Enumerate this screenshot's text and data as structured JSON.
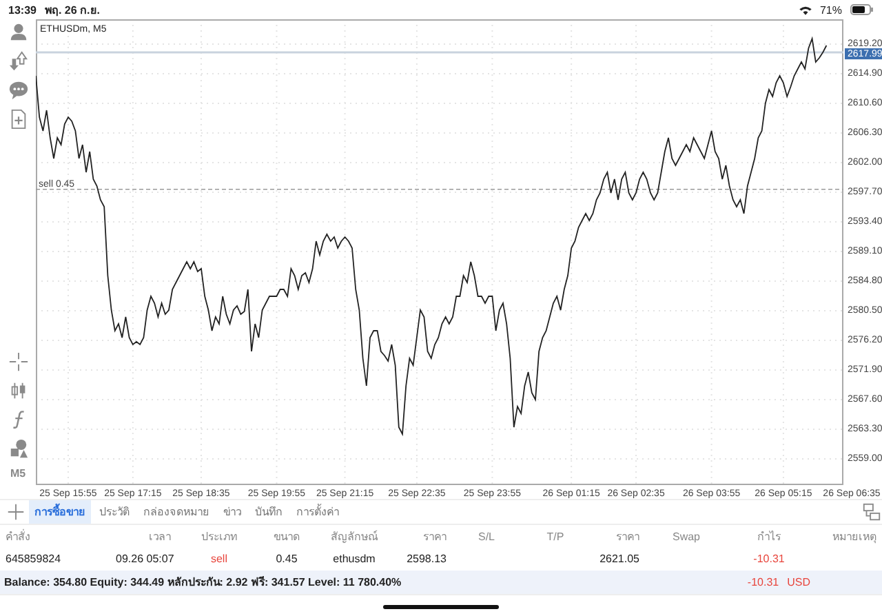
{
  "status_bar": {
    "time": "13:39",
    "date": "พฤ. 26 ก.ย.",
    "battery": "71%"
  },
  "toolbar": {
    "timeframe": "M5"
  },
  "chart": {
    "title": "ETHUSDm, M5",
    "chart_data": {
      "type": "line",
      "ylim": [
        2555.2,
        2622.8
      ],
      "categories": [
        null,
        null,
        null,
        null,
        null,
        null,
        null,
        null,
        null,
        "25 Sep 15:55",
        null,
        null,
        null,
        null,
        null,
        null,
        null,
        null,
        null,
        null,
        null,
        null,
        null,
        null,
        null,
        null,
        null,
        "25 Sep 17:15",
        null,
        null,
        null,
        null,
        null,
        null,
        null,
        null,
        null,
        null,
        null,
        null,
        null,
        null,
        null,
        null,
        null,
        null,
        "25 Sep 18:35",
        null,
        null,
        null,
        null,
        null,
        null,
        null,
        null,
        null,
        null,
        null,
        null,
        null,
        null,
        null,
        null,
        null,
        null,
        null,
        null,
        "25 Sep 19:55",
        null,
        null,
        null,
        null,
        null,
        null,
        null,
        null,
        null,
        null,
        null,
        null,
        null,
        null,
        null,
        null,
        null,
        null,
        "25 Sep 21:15",
        null,
        null,
        null,
        null,
        null,
        null,
        null,
        null,
        null,
        null,
        null,
        null,
        null,
        null,
        null,
        null,
        null,
        null,
        null,
        "25 Sep 22:35",
        null,
        null,
        null,
        null,
        null,
        null,
        null,
        null,
        null,
        null,
        null,
        null,
        null,
        null,
        null,
        null,
        null,
        null,
        null,
        null,
        "25 Sep 23:55",
        null,
        null,
        null,
        null,
        null,
        null,
        null,
        null,
        null,
        null,
        null,
        null,
        null,
        null,
        null,
        null,
        null,
        null,
        null,
        null,
        null,
        "26 Sep 01:15",
        null,
        null,
        null,
        null,
        null,
        null,
        null,
        null,
        null,
        null,
        null,
        null,
        null,
        null,
        null,
        null,
        null,
        "26 Sep 02:35",
        null,
        null,
        null,
        null,
        null,
        null,
        null,
        null,
        null,
        null,
        null,
        null,
        null,
        null,
        null,
        null,
        null,
        null,
        null,
        null,
        "26 Sep 03:55",
        null,
        null,
        null,
        null,
        null,
        null,
        null,
        null,
        null,
        null,
        null,
        null,
        null,
        null,
        null,
        null,
        null,
        null,
        null,
        "26 Sep 05:15",
        null,
        null,
        null,
        null,
        null,
        null,
        null,
        null,
        null,
        null,
        null,
        null,
        null,
        null,
        null,
        null,
        null,
        null,
        "26 Sep 06:35"
      ],
      "yticks": [
        {
          "value": 2619.2,
          "label": "2619.20"
        },
        {
          "value": 2614.9,
          "label": "2614.90"
        },
        {
          "value": 2610.6,
          "label": "2610.60"
        },
        {
          "value": 2606.3,
          "label": "2606.30"
        },
        {
          "value": 2602.0,
          "label": "2602.00"
        },
        {
          "value": 2597.7,
          "label": "2597.70"
        },
        {
          "value": 2593.4,
          "label": "2593.40"
        },
        {
          "value": 2589.1,
          "label": "2589.10"
        },
        {
          "value": 2584.8,
          "label": "2584.80"
        },
        {
          "value": 2580.5,
          "label": "2580.50"
        },
        {
          "value": 2576.2,
          "label": "2576.20"
        },
        {
          "value": 2571.9,
          "label": "2571.90"
        },
        {
          "value": 2567.6,
          "label": "2567.60"
        },
        {
          "value": 2563.3,
          "label": "2563.30"
        },
        {
          "value": 2559.0,
          "label": "2559.00"
        }
      ],
      "series": [
        {
          "color": "#222222",
          "values": [
            2614.6,
            2608.6,
            2606.6,
            2609.6,
            2605.6,
            2602.6,
            2605.6,
            2604.6,
            2607.6,
            2608.6,
            2608.0,
            2606.6,
            2602.6,
            2604.6,
            2600.6,
            2603.6,
            2599.6,
            2598.6,
            2596.6,
            2595.6,
            2585.6,
            2580.6,
            2577.6,
            2578.6,
            2576.6,
            2579.6,
            2576.6,
            2575.6,
            2576.0,
            2575.6,
            2576.6,
            2580.6,
            2582.6,
            2581.6,
            2579.6,
            2581.6,
            2580.0,
            2580.6,
            2583.6,
            2584.6,
            2585.6,
            2586.6,
            2587.6,
            2586.6,
            2587.6,
            2586.2,
            2586.6,
            2582.6,
            2580.6,
            2577.6,
            2579.6,
            2578.6,
            2582.6,
            2580.0,
            2578.6,
            2580.6,
            2581.2,
            2580.0,
            2580.4,
            2583.6,
            2574.6,
            2578.6,
            2576.6,
            2580.6,
            2581.6,
            2582.6,
            2582.6,
            2582.6,
            2583.6,
            2583.6,
            2582.6,
            2586.6,
            2585.6,
            2583.6,
            2585.6,
            2586.0,
            2584.6,
            2586.6,
            2590.6,
            2588.6,
            2590.6,
            2591.6,
            2590.6,
            2591.2,
            2589.6,
            2590.6,
            2591.2,
            2590.6,
            2589.6,
            2583.6,
            2580.6,
            2573.6,
            2569.6,
            2576.6,
            2577.6,
            2577.6,
            2574.6,
            2574.0,
            2573.2,
            2575.6,
            2572.6,
            2563.6,
            2562.6,
            2569.6,
            2573.6,
            2572.6,
            2576.6,
            2580.6,
            2579.6,
            2574.6,
            2573.6,
            2575.6,
            2576.6,
            2578.6,
            2579.6,
            2578.6,
            2579.6,
            2582.6,
            2582.6,
            2585.6,
            2584.6,
            2587.6,
            2585.6,
            2582.6,
            2582.6,
            2581.6,
            2582.6,
            2582.6,
            2577.6,
            2580.6,
            2581.6,
            2578.6,
            2573.6,
            2563.6,
            2566.6,
            2565.6,
            2569.6,
            2571.6,
            2568.6,
            2567.6,
            2574.6,
            2576.6,
            2577.6,
            2579.6,
            2581.6,
            2582.6,
            2580.6,
            2583.6,
            2585.6,
            2589.6,
            2590.6,
            2592.6,
            2593.6,
            2594.6,
            2593.6,
            2594.6,
            2596.6,
            2597.6,
            2599.6,
            2600.6,
            2597.6,
            2599.6,
            2596.6,
            2599.6,
            2600.6,
            2597.6,
            2596.6,
            2597.6,
            2599.6,
            2600.6,
            2599.6,
            2597.6,
            2596.6,
            2597.6,
            2600.6,
            2603.6,
            2605.6,
            2602.6,
            2601.6,
            2602.6,
            2603.6,
            2604.6,
            2603.6,
            2605.6,
            2604.6,
            2603.6,
            2602.6,
            2604.6,
            2606.6,
            2603.6,
            2602.6,
            2599.6,
            2601.6,
            2598.6,
            2596.6,
            2595.6,
            2596.6,
            2594.6,
            2598.6,
            2600.6,
            2602.6,
            2605.6,
            2606.6,
            2610.6,
            2612.6,
            2611.6,
            2613.6,
            2614.6,
            2613.6,
            2611.6,
            2613.0,
            2614.6,
            2615.6,
            2616.6,
            2615.6,
            2618.6,
            2620.0,
            2616.6,
            2617.2,
            2618.0,
            2619.0,
            null,
            null,
            null,
            null,
            null,
            null,
            null
          ]
        }
      ],
      "grid": true,
      "ref_lines": [
        {
          "axis": "y",
          "value": 2617.99,
          "label": "2617.99",
          "color": "#c9d3de"
        },
        {
          "axis": "y",
          "value": 2598.13,
          "label": "sell 0.45",
          "color": "#999999"
        }
      ]
    }
  },
  "tabs": [
    {
      "label": "การซื้อขาย",
      "selected": true
    },
    {
      "label": "ประวัติ",
      "selected": false
    },
    {
      "label": "กล่องจดหมาย",
      "selected": false
    },
    {
      "label": "ข่าว",
      "selected": false
    },
    {
      "label": "บันทึก",
      "selected": false
    },
    {
      "label": "การตั้งค่า",
      "selected": false
    }
  ],
  "table": {
    "columns": [
      "คำสั่ง",
      "เวลา",
      "ประเภท",
      "ขนาด",
      "สัญลักษณ์",
      "ราคา",
      "S/L",
      "T/P",
      "ราคา",
      "Swap",
      "กำไร",
      "หมายเหตุ"
    ],
    "rows": [
      {
        "order": "645859824",
        "time": "09.26 05:07",
        "type": {
          "text": "sell",
          "color": "#e8453c"
        },
        "volume": "0.45",
        "symbol": "ethusdm",
        "open_price": "2598.13",
        "price": "2621.05",
        "profit": {
          "text": "-10.31",
          "color": "#e8453c"
        }
      }
    ]
  },
  "summary": {
    "text": "Balance: 354.80 Equity: 344.49 หลักประกัน: 2.92 ฟรี: 341.57 Level: 11 780.40%",
    "profit": {
      "text": "-10.31",
      "color": "#e8453c"
    },
    "currency": {
      "text": "USD",
      "color": "#e8453c"
    }
  }
}
